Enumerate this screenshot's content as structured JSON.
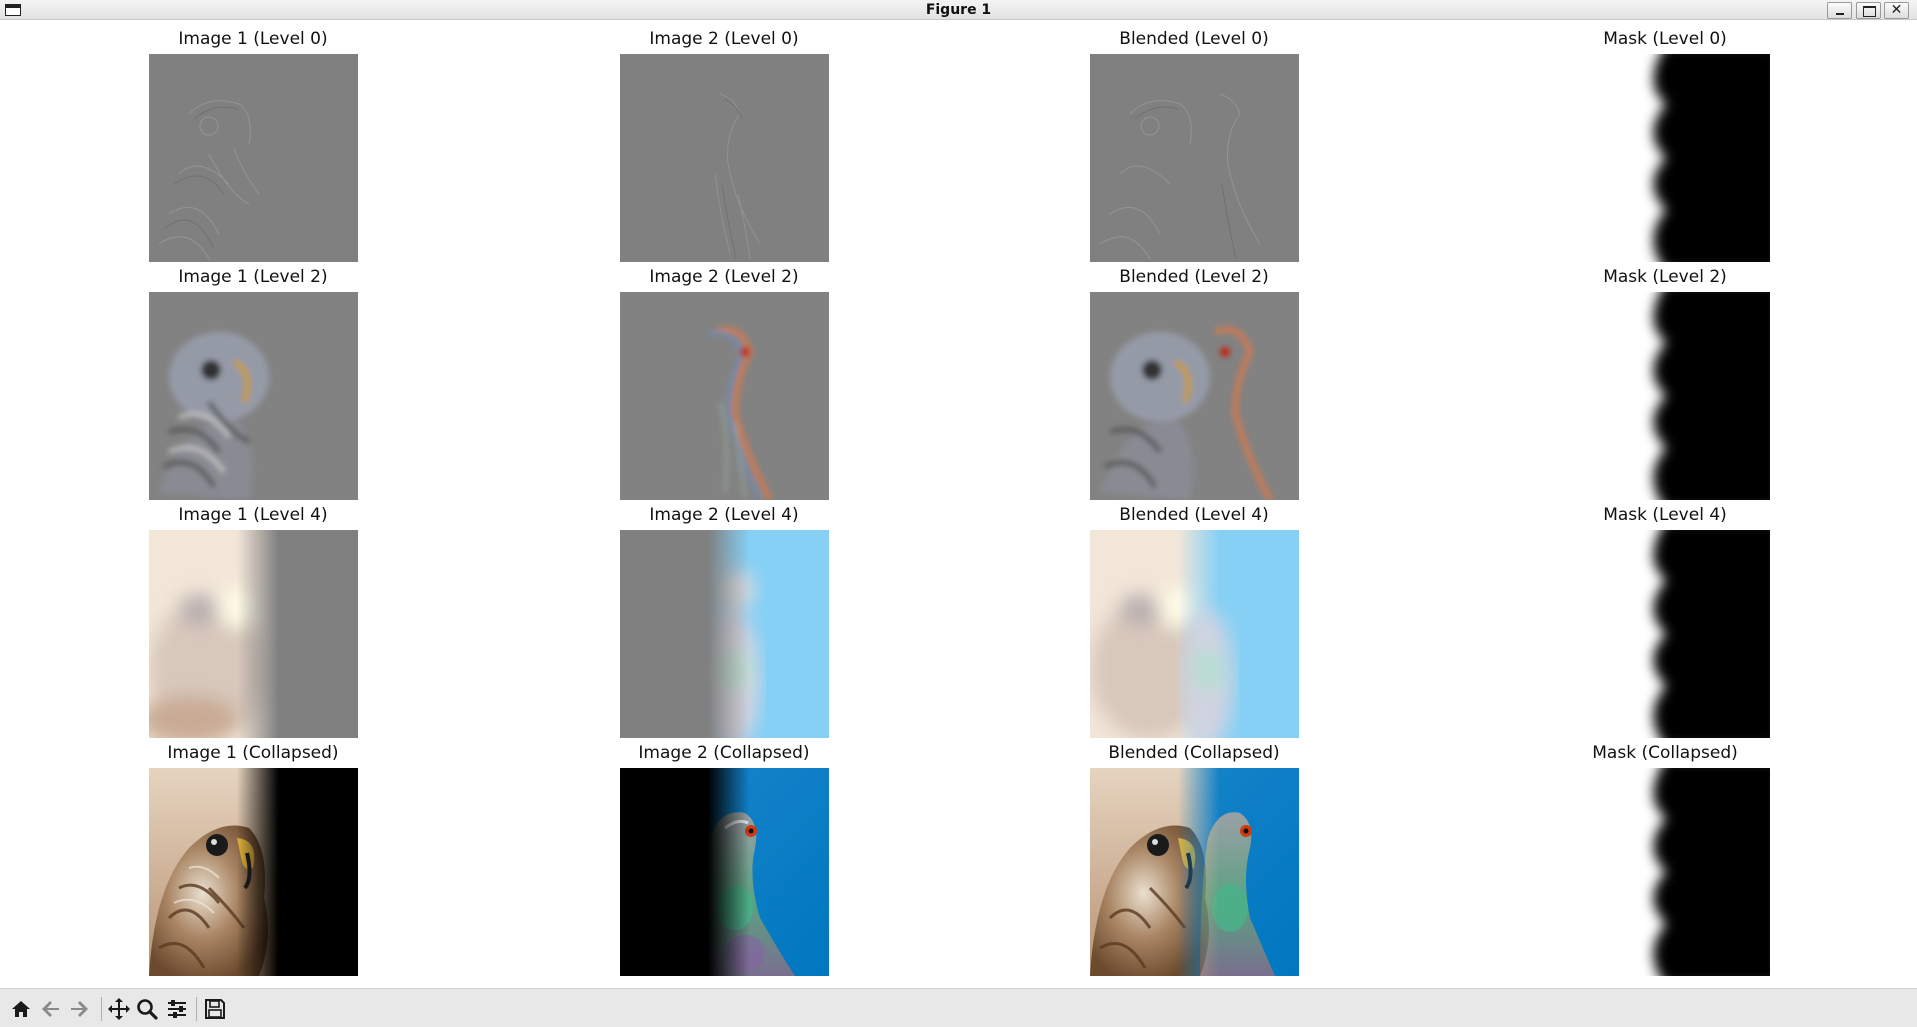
{
  "window": {
    "title": "Figure 1",
    "close_glyph": "✕"
  },
  "panels": [
    [
      "Image 1 (Level 0)",
      "Image 2 (Level 0)",
      "Blended (Level 0)",
      "Mask (Level 0)"
    ],
    [
      "Image 1 (Level 2)",
      "Image 2 (Level 2)",
      "Blended (Level 2)",
      "Mask (Level 2)"
    ],
    [
      "Image 1 (Level 4)",
      "Image 2 (Level 4)",
      "Blended (Level 4)",
      "Mask (Level 4)"
    ],
    [
      "Image 1 (Collapsed)",
      "Image 2 (Collapsed)",
      "Blended (Collapsed)",
      "Mask (Collapsed)"
    ]
  ],
  "toolbar": {
    "icons": [
      "home-icon",
      "back-arrow-icon",
      "forward-arrow-icon",
      "pan-icon",
      "zoom-icon",
      "configure-subplots-icon",
      "save-icon"
    ]
  },
  "colors": {
    "laplacian_grey": "#808080",
    "sky_blue_level4": "#86d0f5",
    "sky_blue_collapsed": "#0a82c8",
    "hawk_tan": "#c9a888",
    "mask_black": "#000000"
  }
}
